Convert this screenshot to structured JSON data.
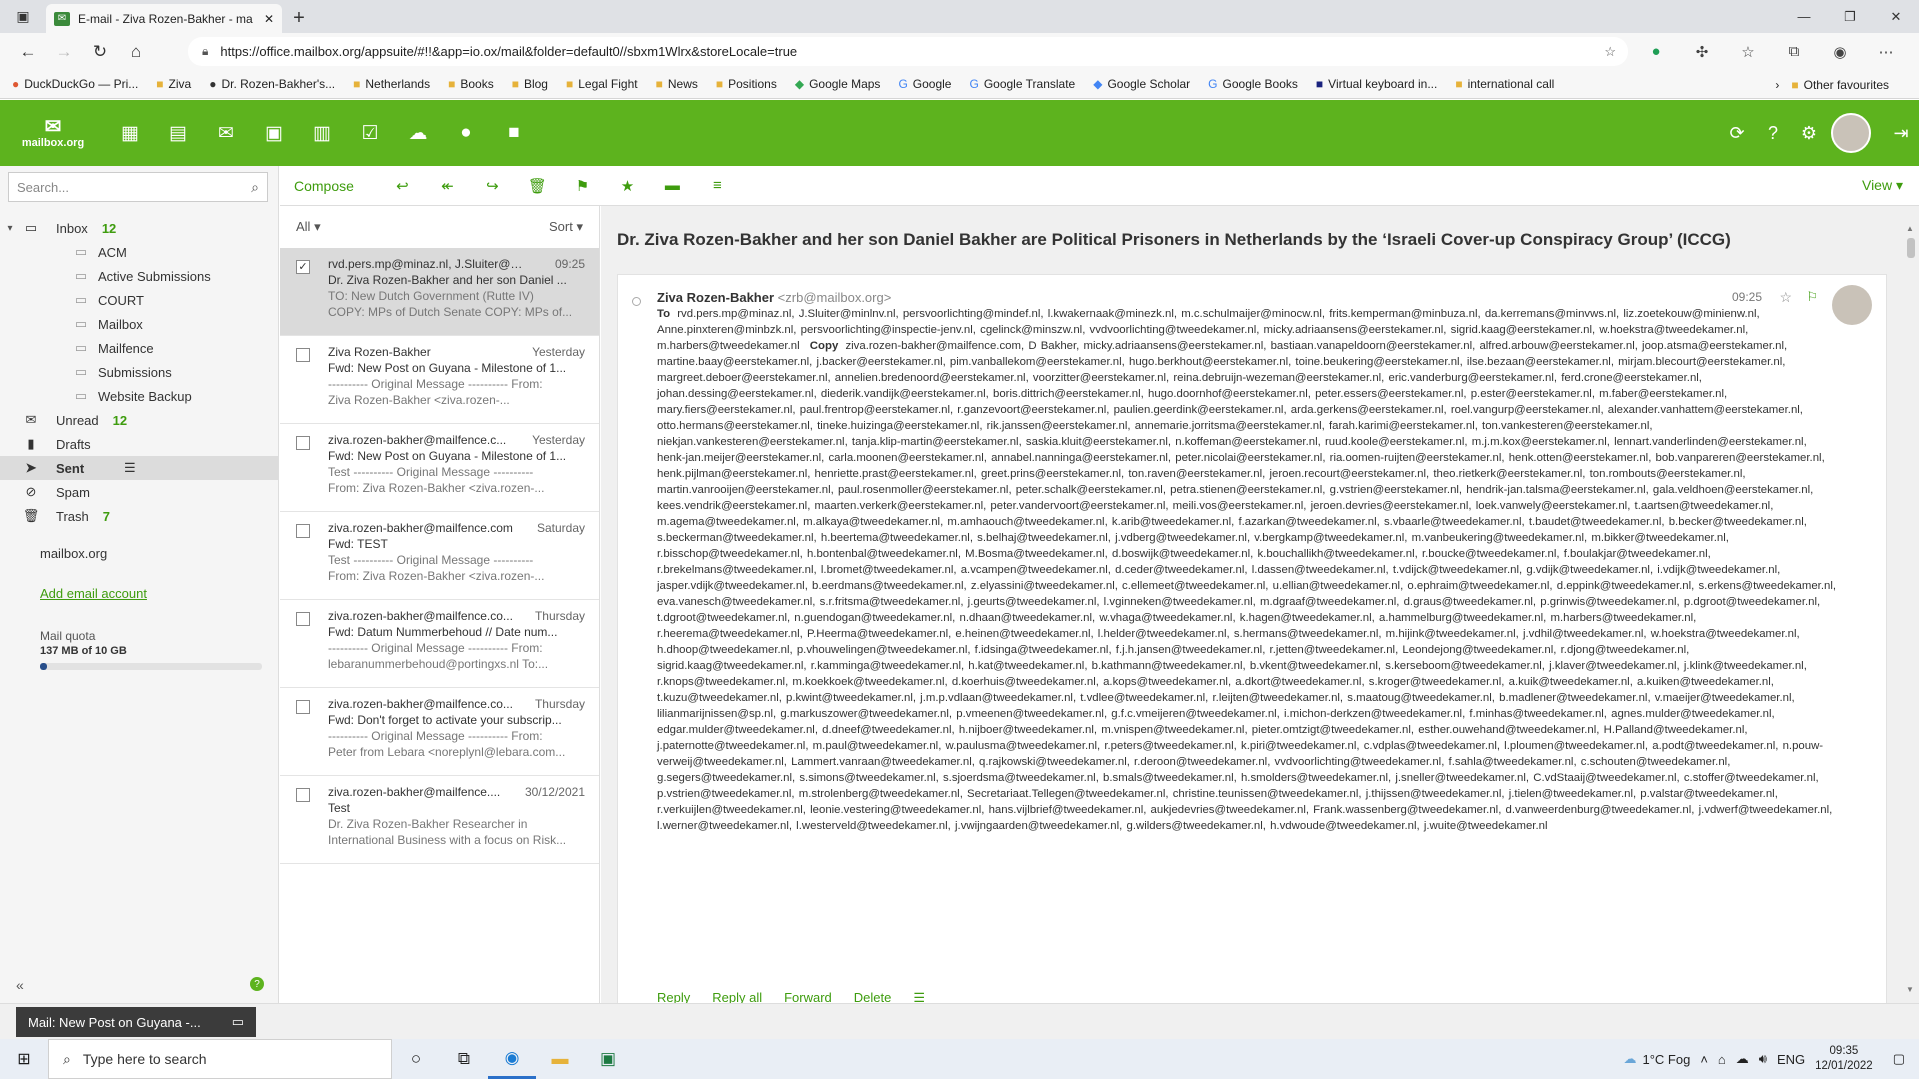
{
  "browser": {
    "tab_title": "E-mail - Ziva Rozen-Bakher - ma",
    "url": "https://office.mailbox.org/appsuite/#!!&app=io.ox/mail&folder=default0//sbxm1Wlrx&storeLocale=true",
    "bookmarks": [
      "DuckDuckGo — Pri...",
      "Ziva",
      "Dr. Rozen-Bakher's...",
      "Netherlands",
      "Books",
      "Blog",
      "Legal Fight",
      "News",
      "Positions",
      "Google Maps",
      "Google",
      "Google Translate",
      "Google Scholar",
      "Google Books",
      "Virtual keyboard in...",
      "international call"
    ],
    "other_favourites": "Other favourites"
  },
  "app": {
    "logo": "mailbox.org",
    "search_placeholder": "Search...",
    "toolbar": {
      "compose": "Compose",
      "view": "View"
    }
  },
  "folders": [
    {
      "label": "Inbox",
      "count": "12",
      "level": 0,
      "icon": "inbox-icon"
    },
    {
      "label": "ACM",
      "level": 1
    },
    {
      "label": "Active Submissions",
      "level": 1
    },
    {
      "label": "COURT",
      "level": 1
    },
    {
      "label": "Mailbox",
      "level": 1
    },
    {
      "label": "Mailfence",
      "level": 1
    },
    {
      "label": "Submissions",
      "level": 1
    },
    {
      "label": "Website Backup",
      "level": 1
    },
    {
      "label": "Unread",
      "count": "12",
      "level": 0,
      "icon": "envelope-icon"
    },
    {
      "label": "Drafts",
      "level": 0,
      "icon": "file-icon"
    },
    {
      "label": "Sent",
      "level": 0,
      "icon": "send-icon",
      "selected": true
    },
    {
      "label": "Spam",
      "level": 0,
      "icon": "ban-icon"
    },
    {
      "label": "Trash",
      "count": "7",
      "level": 0,
      "icon": "trash-icon"
    }
  ],
  "sidebar": {
    "account": "mailbox.org",
    "add_account": "Add email account",
    "quota_label": "Mail quota",
    "quota_value": "137 MB of 10 GB",
    "quota_fraction": 0.0137
  },
  "list": {
    "filter": "All",
    "sort": "Sort",
    "items": [
      {
        "from": "rvd.pers.mp@minaz.nl, J.Sluiter@mi...",
        "date": "09:25",
        "subject": "Dr. Ziva Rozen-Bakher and her son Daniel ...",
        "preview": "TO: New Dutch Government (Rutte IV)",
        "preview2": "COPY: MPs of Dutch Senate  COPY: MPs of...",
        "selected": true
      },
      {
        "from": "Ziva Rozen-Bakher",
        "date": "Yesterday",
        "subject": "Fwd: New Post on Guyana - Milestone of 1...",
        "preview": "---------- Original Message ---------- From:",
        "preview2": "Ziva Rozen-Bakher <ziva.rozen-..."
      },
      {
        "from": "ziva.rozen-bakher@mailfence.c...",
        "date": "Yesterday",
        "subject": "Fwd: New Post on Guyana - Milestone of 1...",
        "preview": "Test ---------- Original Message ----------",
        "preview2": "From: Ziva Rozen-Bakher <ziva.rozen-..."
      },
      {
        "from": "ziva.rozen-bakher@mailfence.com",
        "date": "Saturday",
        "subject": "Fwd: TEST",
        "preview": "Test ---------- Original Message ----------",
        "preview2": "From: Ziva Rozen-Bakher <ziva.rozen-..."
      },
      {
        "from": "ziva.rozen-bakher@mailfence.co...",
        "date": "Thursday",
        "subject": "Fwd: Datum Nummerbehoud // Date num...",
        "preview": "---------- Original Message ---------- From:",
        "preview2": "lebaranummerbehoud@portingxs.nl To:..."
      },
      {
        "from": "ziva.rozen-bakher@mailfence.co...",
        "date": "Thursday",
        "subject": "Fwd: Don't forget to activate your subscrip...",
        "preview": "---------- Original Message ---------- From:",
        "preview2": "Peter from Lebara <noreplynl@lebara.com..."
      },
      {
        "from": "ziva.rozen-bakher@mailfence....",
        "date": "30/12/2021",
        "subject": "Test",
        "preview": "Dr. Ziva Rozen-Bakher Researcher in",
        "preview2": "International Business with a focus on Risk..."
      }
    ]
  },
  "message": {
    "subject": "Dr. Ziva Rozen-Bakher and her son Daniel Bakher are Political Prisoners in Netherlands by the ‘Israeli Cover-up Conspiracy Group’ (ICCG)",
    "from_name": "Ziva Rozen-Bakher",
    "from_addr": "<zrb@mailbox.org>",
    "time": "09:25",
    "to_label": "To",
    "copy_label": "Copy",
    "to_part1": "rvd.pers.mp@minaz.nl,  J.Sluiter@minlnv.nl,  persvoorlichting@mindef.nl,  l.kwakernaak@minezk.nl,  m.c.schulmaijer@minocw.nl,  frits.kemperman@minbuza.nl,  da.kerremans@minvws.nl,  liz.zoetekouw@minienw.nl,  Anne.pinxteren@minbzk.nl,  persvoorlichting@inspectie-jenv.nl,  cgelinck@minszw.nl,  vvdvoorlichting@tweedekamer.nl,  micky.adriaansens@eerstekamer.nl,  sigrid.kaag@eerstekamer.nl,  w.hoekstra@tweedekamer.nl,  m.harbers@tweedekamer.nl",
    "copy_part": "ziva.rozen-bakher@mailfence.com,  D Bakher,  micky.adriaansens@eerstekamer.nl,  bastiaan.vanapeldoorn@eerstekamer.nl,  alfred.arbouw@eerstekamer.nl,  joop.atsma@eerstekamer.nl,  martine.baay@eerstekamer.nl,  j.backer@eerstekamer.nl,  pim.vanballekom@eerstekamer.nl,  hugo.berkhout@eerstekamer.nl,  toine.beukering@eerstekamer.nl,  ilse.bezaan@eerstekamer.nl,  mirjam.blecourt@eerstekamer.nl,  margreet.deboer@eerstekamer.nl,  annelien.bredenoord@eerstekamer.nl,  voorzitter@eerstekamer.nl,  reina.debruijn-wezeman@eerstekamer.nl,  eric.vanderburg@eerstekamer.nl,  ferd.crone@eerstekamer.nl,  johan.dessing@eerstekamer.nl,  diederik.vandijk@eerstekamer.nl,  boris.dittrich@eerstekamer.nl,  hugo.doornhof@eerstekamer.nl,  peter.essers@eerstekamer.nl,  p.ester@eerstekamer.nl,  m.faber@eerstekamer.nl,  mary.fiers@eerstekamer.nl,  paul.frentrop@eerstekamer.nl,  r.ganzevoort@eerstekamer.nl,  paulien.geerdink@eerstekamer.nl,  arda.gerkens@eerstekamer.nl,  roel.vangurp@eerstekamer.nl,  alexander.vanhattem@eerstekamer.nl,  otto.hermans@eerstekamer.nl,  tineke.huizinga@eerstekamer.nl,  rik.janssen@eerstekamer.nl,  annemarie.jorritsma@eerstekamer.nl,  farah.karimi@eerstekamer.nl,  ton.vankesteren@eerstekamer.nl,  niekjan.vankesteren@eerstekamer.nl,  tanja.klip-martin@eerstekamer.nl,  saskia.kluit@eerstekamer.nl,  n.koffeman@eerstekamer.nl,  ruud.koole@eerstekamer.nl,  m.j.m.kox@eerstekamer.nl,  lennart.vanderlinden@eerstekamer.nl,  henk-jan.meijer@eerstekamer.nl,  carla.moonen@eerstekamer.nl,  annabel.nanninga@eerstekamer.nl,  peter.nicolai@eerstekamer.nl,  ria.oomen-ruijten@eerstekamer.nl,  henk.otten@eerstekamer.nl,  bob.vanpareren@eerstekamer.nl,  henk.pijlman@eerstekamer.nl,  henriette.prast@eerstekamer.nl,  greet.prins@eerstekamer.nl,  ton.raven@eerstekamer.nl,  jeroen.recourt@eerstekamer.nl,  theo.rietkerk@eerstekamer.nl,  ton.rombouts@eerstekamer.nl,  martin.vanrooijen@eerstekamer.nl,  paul.rosenmoller@eerstekamer.nl,  peter.schalk@eerstekamer.nl,  petra.stienen@eerstekamer.nl,  g.vstrien@eerstekamer.nl,  hendrik-jan.talsma@eerstekamer.nl,  gala.veldhoen@eerstekamer.nl,  kees.vendrik@eerstekamer.nl,  maarten.verkerk@eerstekamer.nl,  peter.vandervoort@eerstekamer.nl,  meili.vos@eerstekamer.nl,  jeroen.devries@eerstekamer.nl,  loek.vanwely@eerstekamer.nl,  t.aartsen@tweedekamer.nl,  m.agema@tweedekamer.nl,  m.alkaya@tweedekamer.nl,  m.amhaouch@tweedekamer.nl,  k.arib@tweedekamer.nl,  f.azarkan@tweedekamer.nl,  s.vbaarle@tweedekamer.nl,  t.baudet@tweedekamer.nl,  b.becker@tweedekamer.nl,  s.beckerman@tweedekamer.nl,  h.beertema@tweedekamer.nl,  s.belhaj@tweedekamer.nl,  j.vdberg@tweedekamer.nl,  v.bergkamp@tweedekamer.nl,  m.vanbeukering@tweedekamer.nl,  m.bikker@tweedekamer.nl,  r.bisschop@tweedekamer.nl,  h.bontenbal@tweedekamer.nl,  M.Bosma@tweedekamer.nl,  d.boswijk@tweedekamer.nl,  k.bouchallikh@tweedekamer.nl,  r.boucke@tweedekamer.nl,  f.boulakjar@tweedekamer.nl,  r.brekelmans@tweedekamer.nl,  l.bromet@tweedekamer.nl,  a.vcampen@tweedekamer.nl,  d.ceder@tweedekamer.nl,  l.dassen@tweedekamer.nl,  t.vdijck@tweedekamer.nl,  g.vdijk@tweedekamer.nl,  i.vdijk@tweedekamer.nl,  jasper.vdijk@tweedekamer.nl,  b.eerdmans@tweedekamer.nl,  z.elyassini@tweedekamer.nl,  c.ellemeet@tweedekamer.nl,  u.ellian@tweedekamer.nl,  o.ephraim@tweedekamer.nl,  d.eppink@tweedekamer.nl,  s.erkens@tweedekamer.nl,  eva.vanesch@tweedekamer.nl,  s.r.fritsma@tweedekamer.nl,  j.geurts@tweedekamer.nl,  l.vginneken@tweedekamer.nl,  m.dgraaf@tweedekamer.nl,  d.graus@tweedekamer.nl,  p.grinwis@tweedekamer.nl,  p.dgroot@tweedekamer.nl,  t.dgroot@tweedekamer.nl,  n.guendogan@tweedekamer.nl,  n.dhaan@tweedekamer.nl,  w.vhaga@tweedekamer.nl,  k.hagen@tweedekamer.nl,  a.hammelburg@tweedekamer.nl,  m.harbers@tweedekamer.nl,  r.heerema@tweedekamer.nl,  P.Heerma@tweedekamer.nl,  e.heinen@tweedekamer.nl,  l.helder@tweedekamer.nl,  s.hermans@tweedekamer.nl,  m.hijink@tweedekamer.nl,  j.vdhil@tweedekamer.nl,  w.hoekstra@tweedekamer.nl,  h.dhoop@tweedekamer.nl,  p.vhouwelingen@tweedekamer.nl,  f.idsinga@tweedekamer.nl,  f.j.h.jansen@tweedekamer.nl,  r.jetten@tweedekamer.nl,  Leondejong@tweedekamer.nl,  r.djong@tweedekamer.nl,  sigrid.kaag@tweedekamer.nl,  r.kamminga@tweedekamer.nl,  h.kat@tweedekamer.nl,  b.kathmann@tweedekamer.nl,  b.vkent@tweedekamer.nl,  s.kerseboom@tweedekamer.nl,  j.klaver@tweedekamer.nl,  j.klink@tweedekamer.nl,  r.knops@tweedekamer.nl,  m.koekkoek@tweedekamer.nl,  d.koerhuis@tweedekamer.nl,  a.kops@tweedekamer.nl,  a.dkort@tweedekamer.nl,  s.kroger@tweedekamer.nl,  a.kuik@tweedekamer.nl,  a.kuiken@tweedekamer.nl,  t.kuzu@tweedekamer.nl,  p.kwint@tweedekamer.nl,  j.m.p.vdlaan@tweedekamer.nl,  t.vdlee@tweedekamer.nl,  r.leijten@tweedekamer.nl,  s.maatoug@tweedekamer.nl,  b.madlener@tweedekamer.nl,  v.maeijer@tweedekamer.nl,  lilianmarijnissen@sp.nl,  g.markuszower@tweedekamer.nl,  p.vmeenen@tweedekamer.nl,  g.f.c.vmeijeren@tweedekamer.nl,  i.michon-derkzen@tweedekamer.nl,  f.minhas@tweedekamer.nl,  agnes.mulder@tweedekamer.nl,  edgar.mulder@tweedekamer.nl,  d.dneef@tweedekamer.nl,  h.nijboer@tweedekamer.nl,  m.vnispen@tweedekamer.nl,  pieter.omtzigt@tweedekamer.nl,  esther.ouwehand@tweedekamer.nl,  H.Palland@tweedekamer.nl,  j.paternotte@tweedekamer.nl,  m.paul@tweedekamer.nl,  w.paulusma@tweedekamer.nl,  r.peters@tweedekamer.nl,  k.piri@tweedekamer.nl,  c.vdplas@tweedekamer.nl,  l.ploumen@tweedekamer.nl,  a.podt@tweedekamer.nl,  n.pouw-verweij@tweedekamer.nl,  Lammert.vanraan@tweedekamer.nl,  q.rajkowski@tweedekamer.nl,  r.deroon@tweedekamer.nl,  vvdvoorlichting@tweedekamer.nl,  f.sahla@tweedekamer.nl,  c.schouten@tweedekamer.nl,  g.segers@tweedekamer.nl,  s.simons@tweedekamer.nl,  s.sjoerdsma@tweedekamer.nl,  b.smals@tweedekamer.nl,  h.smolders@tweedekamer.nl,  j.sneller@tweedekamer.nl,  C.vdStaaij@tweedekamer.nl,  c.stoffer@tweedekamer.nl,  p.vstrien@tweedekamer.nl,  m.strolenberg@tweedekamer.nl,  Secretariaat.Tellegen@tweedekamer.nl,  christine.teunissen@tweedekamer.nl,  j.thijssen@tweedekamer.nl,  j.tielen@tweedekamer.nl,  p.valstar@tweedekamer.nl,  r.verkuijlen@tweedekamer.nl,  leonie.vestering@tweedekamer.nl,  hans.vijlbrief@tweedekamer.nl,  aukjedevries@tweedekamer.nl,  Frank.wassenberg@tweedekamer.nl,  d.vanweerdenburg@tweedekamer.nl,  j.vdwerf@tweedekamer.nl,  l.werner@tweedekamer.nl,  l.westerveld@tweedekamer.nl,  j.vwijngaarden@tweedekamer.nl,  g.wilders@tweedekamer.nl,  h.vdwoude@tweedekamer.nl,  j.wuite@tweedekamer.nl",
    "actions": [
      "Reply",
      "Reply all",
      "Forward",
      "Delete"
    ]
  },
  "notification": "Mail: New Post on Guyana -...",
  "taskbar": {
    "search_placeholder": "Type here to search",
    "weather": "1°C  Fog",
    "lang": "ENG",
    "time": "09:35",
    "date": "12/01/2022"
  },
  "colors": {
    "brand": "#5db31e",
    "link": "#3e9c0e"
  }
}
